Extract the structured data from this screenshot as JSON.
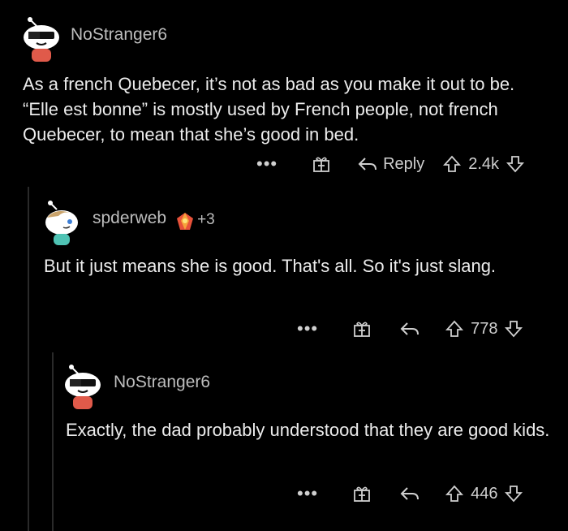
{
  "comments": [
    {
      "username": "NoStranger6",
      "body": "As a french Quebecer, it’s not as bad as you make it out to be. “Elle est bonne” is mostly used by French people, not french Quebecer, to mean that she’s good in bed.",
      "reply_label": "Reply",
      "score": "2.4k"
    },
    {
      "username": "spderweb",
      "award_count": "+3",
      "body": "But it just means she is good.  That's all.  So it's just slang.",
      "score": "778"
    },
    {
      "username": "NoStranger6",
      "body": "Exactly, the dad probably understood that they are good kids.",
      "score": "446"
    }
  ],
  "more_label": "•••",
  "icons": {
    "more": "more-icon",
    "gift": "gift-icon",
    "reply": "reply-arrow-icon",
    "upvote": "upvote-icon",
    "downvote": "downvote-icon"
  },
  "colors": {
    "background": "#000000",
    "text": "#ececec",
    "muted": "#bdbdbd",
    "avatar_shirt_red": "#e05a4a",
    "avatar_shirt_teal": "#4fc3b4"
  }
}
